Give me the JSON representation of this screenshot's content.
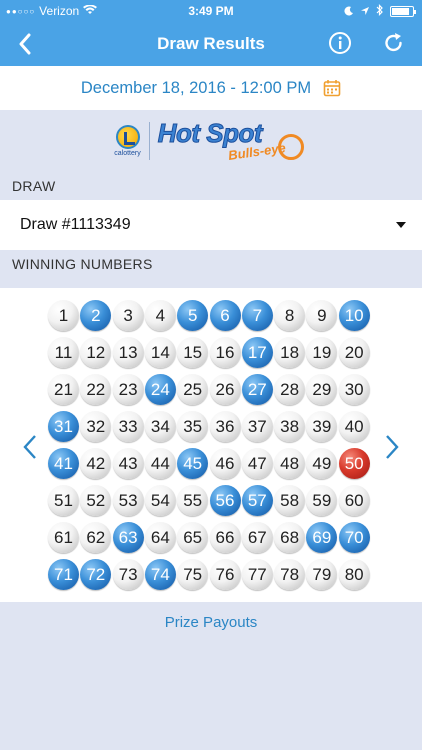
{
  "status_bar": {
    "carrier": "Verizon",
    "time": "3:49 PM"
  },
  "nav": {
    "title": "Draw Results",
    "back_icon": "chevron-left-icon",
    "info_icon": "info-icon",
    "refresh_icon": "refresh-icon"
  },
  "date": {
    "text": "December 18, 2016 - 12:00 PM",
    "icon": "calendar-icon"
  },
  "logo": {
    "brand_small": "calottery",
    "title": "Hot Spot",
    "subtitle": "Bulls-eye"
  },
  "draw": {
    "label": "DRAW",
    "value": "Draw #1113349"
  },
  "winning": {
    "label": "WINNING NUMBERS",
    "numbers": [
      1,
      2,
      3,
      4,
      5,
      6,
      7,
      8,
      9,
      10,
      11,
      12,
      13,
      14,
      15,
      16,
      17,
      18,
      19,
      20,
      21,
      22,
      23,
      24,
      25,
      26,
      27,
      28,
      29,
      30,
      31,
      32,
      33,
      34,
      35,
      36,
      37,
      38,
      39,
      40,
      41,
      42,
      43,
      44,
      45,
      46,
      47,
      48,
      49,
      50,
      51,
      52,
      53,
      54,
      55,
      56,
      57,
      58,
      59,
      60,
      61,
      62,
      63,
      64,
      65,
      66,
      67,
      68,
      69,
      70,
      71,
      72,
      73,
      74,
      75,
      76,
      77,
      78,
      79,
      80
    ],
    "drawn": [
      2,
      5,
      6,
      7,
      10,
      17,
      24,
      27,
      31,
      41,
      45,
      56,
      57,
      63,
      69,
      70,
      71,
      72,
      74
    ],
    "bulls_eye": 50,
    "prev_label": "<",
    "next_label": ">"
  },
  "footer": {
    "prize_payouts": "Prize Payouts"
  },
  "colors": {
    "accent": "#4aa3e6",
    "link": "#2b86c5",
    "hit_ball": "#2a78c6",
    "bulls_eye_ball": "#d8392b"
  }
}
